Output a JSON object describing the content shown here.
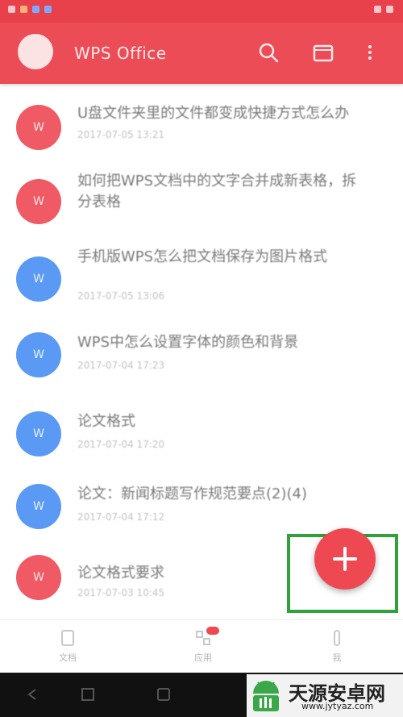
{
  "app_bar": {
    "title": "WPS Office"
  },
  "documents": [
    {
      "title": "U盘文件夹里的文件都变成快捷方式怎么办",
      "date": "2017-07-05  13:21",
      "color": "red"
    },
    {
      "title": "如何把WPS文档中的文字合并成新表格，拆分表格",
      "date": "",
      "color": "red"
    },
    {
      "title": "手机版WPS怎么把文档保存为图片格式",
      "date": "2017-07-05  13:06",
      "color": "blue"
    },
    {
      "title": "WPS中怎么设置字体的颜色和背景",
      "date": "2017-07-04  17:23",
      "color": "blue"
    },
    {
      "title": "论文格式",
      "date": "2017-07-04  17:20",
      "color": "blue"
    },
    {
      "title": "论文：新闻标题写作规范要点(2)(4)",
      "date": "2017-07-04  17:12",
      "color": "blue"
    },
    {
      "title": "论文格式要求",
      "date": "2017-07-03  10:45",
      "color": "red"
    }
  ],
  "bottom_nav": [
    {
      "label": "文档",
      "icon": "document-icon"
    },
    {
      "label": "应用",
      "icon": "apps-icon"
    },
    {
      "label": "我",
      "icon": "person-icon"
    }
  ],
  "fab": {
    "icon": "plus-icon",
    "color": "#ee4852"
  },
  "highlight_color": "#2fa23a",
  "watermark": {
    "text": "天源安卓网",
    "url": "www.jytyaz.com"
  }
}
